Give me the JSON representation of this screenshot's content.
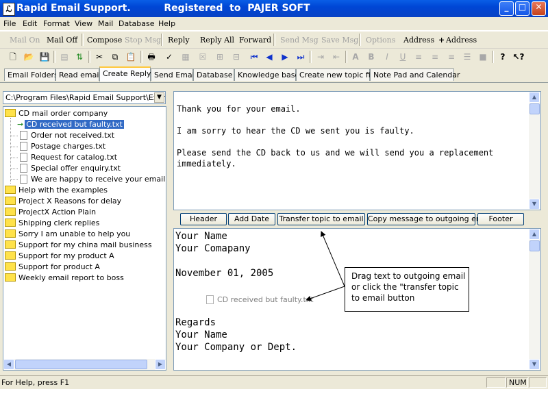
{
  "window": {
    "title": "Rapid Email Support.          Registered  to  PAJER SOFT",
    "minimize_label": "_",
    "maximize_label": "□",
    "close_label": "✕"
  },
  "menu": [
    "File",
    "Edit",
    "Format",
    "View",
    "Mail",
    "Database",
    "Help"
  ],
  "text_toolbar": {
    "mail_on": "Mail On",
    "mail_off": "Mail Off",
    "compose": "Compose",
    "stop_msg": "Stop Msg",
    "reply": "Reply",
    "reply_all": "Reply All",
    "forward": "Forward",
    "send_msg": "Send Msg",
    "save_msg": "Save Msg",
    "options": "Options",
    "address": "Address",
    "add_address": "Address",
    "add_address_prefix": "+"
  },
  "tabs": [
    "Email Folders",
    "Read email",
    "Create Reply",
    "Send Email",
    "Database",
    "Knowledge base",
    "Create new topic file",
    "Note Pad and Calendar"
  ],
  "active_tab": "Create Reply",
  "path": "C:\\Program Files\\Rapid Email Support\\Examp",
  "tree": {
    "root_open": "CD mail order company",
    "children": [
      "CD received but faulty.txt",
      "Order not received.txt",
      "Postage charges.txt",
      "Request for catalog.txt",
      "Special offer enquiry.txt",
      "We are happy to receive your email order."
    ],
    "folders": [
      "Help with the examples",
      "Project X  Reasons for delay",
      "ProjectX  Action Plain",
      "Shipping clerk replies",
      "Sorry I am unable to help you",
      "Support for my china mail business",
      "Support for my product A",
      "Support for product A",
      "Weekly email report to boss"
    ]
  },
  "topic_text": {
    "line1": "Thank you for your email.",
    "line2": "I am sorry to hear the CD we sent you is faulty.",
    "line3": "Please send the CD back to us and we will send you a replacement",
    "line4": "immediately."
  },
  "buttons": {
    "header": "Header",
    "add_date": "Add Date",
    "transfer": "Transfer topic to email",
    "copy_message": "Copy message to outgoing email",
    "footer": "Footer"
  },
  "outgoing": {
    "name": "Your Name",
    "company": "Your Comapany",
    "date": "November 01, 2005",
    "dragged_file": "CD received but faulty.txt",
    "regards": "Regards",
    "name2": "Your Name",
    "company2": "Your Company or Dept."
  },
  "callout": {
    "line1": "Drag text to outgoing email",
    "line2": "or click the \"transfer topic",
    "line3": "to email button"
  },
  "status": {
    "help": "For Help, press F1",
    "num": "NUM"
  },
  "colors": {
    "titlebar": "#0a5ee6",
    "selection": "#316ac5",
    "active_tab_accent": "#ffc83c",
    "chrome": "#ece9d8",
    "arrow_green": "#1f8a1f"
  }
}
